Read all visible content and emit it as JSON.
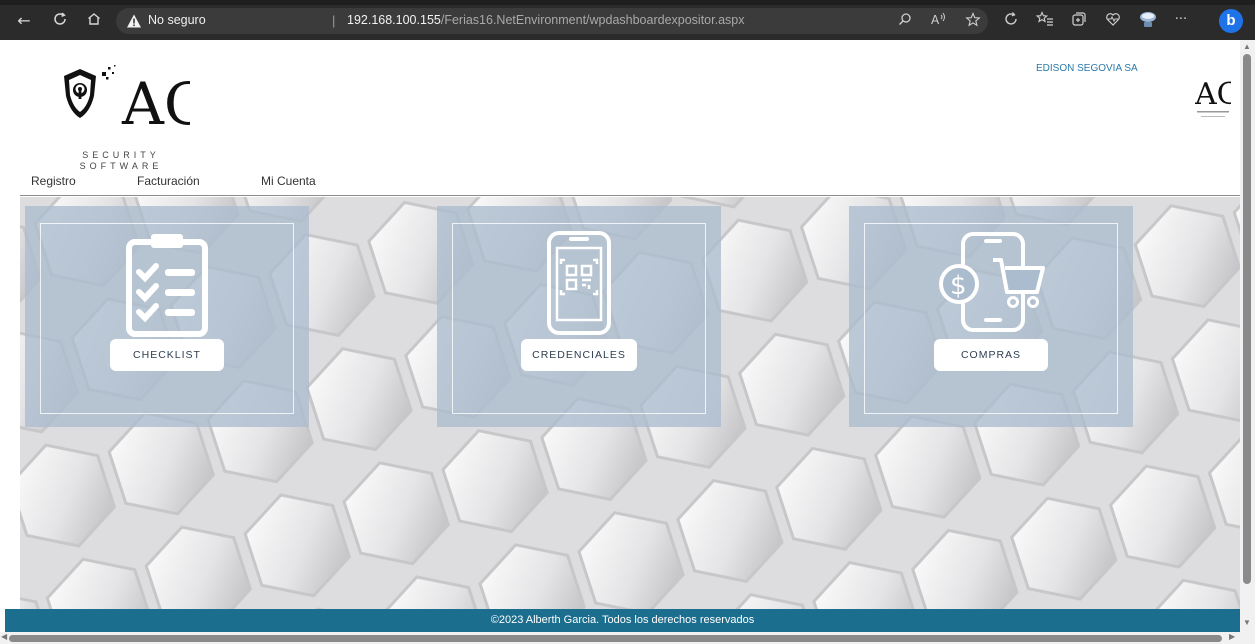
{
  "browser": {
    "security_label": "No seguro",
    "separator": "|",
    "url_host": "192.168.100.155",
    "url_path": "/Ferias16.NetEnvironment/wpdashboardexpositor.aspx",
    "nav_icons": {
      "back": "←",
      "refresh": "C",
      "home": "⌂"
    },
    "toolbar_icons": [
      "search-icon",
      "read-aloud-icon",
      "favorite-icon",
      "refresh-site-icon",
      "favorites-icon",
      "collections-icon",
      "health-icon",
      "profile-icon",
      "more-icon"
    ],
    "more_label": "···",
    "bing_label": "b"
  },
  "header": {
    "logo_text": "AG",
    "logo_subtitle_1": "SECURITY",
    "logo_subtitle_2": "SOFTWARE",
    "company_name": "EDISON SEGOVIA SA",
    "mini_logo_text": "AG"
  },
  "menu": {
    "items": [
      {
        "label": "Registro"
      },
      {
        "label": "Facturación"
      },
      {
        "label": "Mi Cuenta"
      }
    ]
  },
  "cards": [
    {
      "label": "CHECKLIST",
      "icon": "clipboard-checklist-icon"
    },
    {
      "label": "CREDENCIALES",
      "icon": "qr-phone-icon"
    },
    {
      "label": "COMPRAS",
      "icon": "phone-cart-dollar-icon"
    }
  ],
  "footer": {
    "text": "©2023 Alberth Garcia. Todos los derechos reservados"
  },
  "colors": {
    "chrome": "#2b2b2b",
    "card_overlay": "#aabccE",
    "footer": "#1b6e8e",
    "company": "#2a79a8"
  }
}
